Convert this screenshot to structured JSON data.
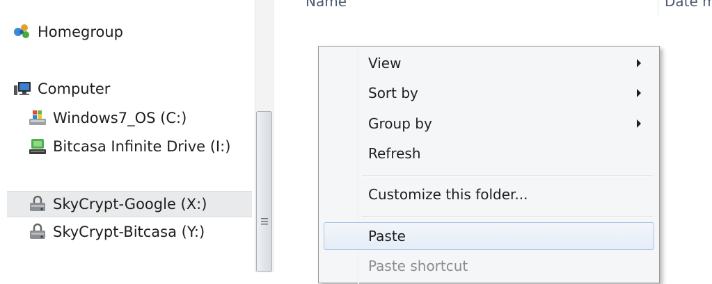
{
  "nav": {
    "homegroup_label": "Homegroup",
    "computer_label": "Computer",
    "drives": [
      {
        "label": "Windows7_OS (C:)"
      },
      {
        "label": "Bitcasa Infinite Drive (I:)"
      },
      {
        "label": "SkyCrypt-Google (X:)"
      },
      {
        "label": "SkyCrypt-Bitcasa (Y:)"
      }
    ]
  },
  "content": {
    "columns": [
      "Name",
      "Date m"
    ]
  },
  "context_menu": {
    "items": [
      {
        "label": "View"
      },
      {
        "label": "Sort by"
      },
      {
        "label": "Group by"
      },
      {
        "label": "Refresh"
      },
      {
        "label": "Customize this folder..."
      },
      {
        "label": "Paste"
      },
      {
        "label": "Paste shortcut"
      }
    ]
  },
  "colors": {
    "selection_bg": "#e9eaeb",
    "hover_border": "#a9c4e6",
    "menu_bg": "#f5f6f7"
  }
}
